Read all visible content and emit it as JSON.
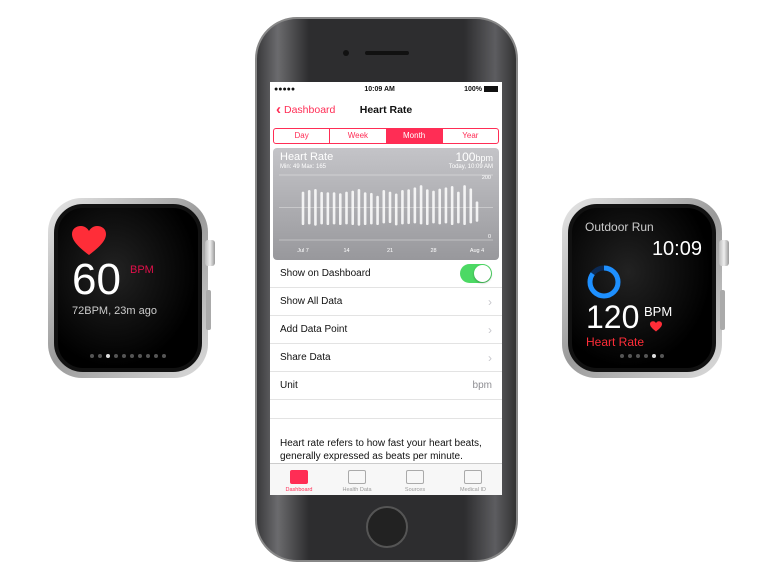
{
  "colors": {
    "accent": "#ff2d55",
    "toggle_on": "#4cd964",
    "ring": "#1e90ff"
  },
  "left_watch": {
    "icon": "heart-icon",
    "value": "60",
    "unit": "BPM",
    "sub": "72BPM, 23m ago",
    "page_count": 10,
    "page_active": 3
  },
  "right_watch": {
    "title": "Outdoor Run",
    "time": "10:09",
    "ring_progress": 0.85,
    "value": "120",
    "unit": "BPM",
    "label": "Heart Rate",
    "icon": "heart-icon",
    "page_count": 6,
    "page_active": 5
  },
  "phone": {
    "status": {
      "signal": "●●●●●",
      "time": "10:09 AM",
      "battery": "100%"
    },
    "nav": {
      "back": "Dashboard",
      "title": "Heart Rate"
    },
    "segments": [
      "Day",
      "Week",
      "Month",
      "Year"
    ],
    "active_segment": "Month",
    "rows": [
      {
        "label": "Show on Dashboard",
        "toggle": true
      },
      {
        "label": "Show All Data",
        "chevron": true
      },
      {
        "label": "Add Data Point",
        "chevron": true
      },
      {
        "label": "Share Data",
        "chevron": true
      },
      {
        "label": "Unit",
        "value": "bpm"
      }
    ],
    "description": "Heart rate refers to how fast your heart beats, generally expressed as beats per minute.",
    "tabs": [
      {
        "label": "Dashboard",
        "icon": "dashboard-icon",
        "active": true
      },
      {
        "label": "Health Data",
        "icon": "health-data-icon"
      },
      {
        "label": "Sources",
        "icon": "sources-icon"
      },
      {
        "label": "Medical ID",
        "icon": "medical-id-icon"
      }
    ]
  },
  "chart_data": {
    "type": "range-bar",
    "title": "Heart Rate",
    "summary": "Min: 49  Max: 165",
    "latest_value": "100",
    "latest_unit": "bpm",
    "latest_time": "Today, 10:09 AM",
    "ylim": [
      0,
      200
    ],
    "y_ticks": [
      "200",
      "0"
    ],
    "x_ticks": [
      "Jul 7",
      "14",
      "21",
      "28",
      "Aug 4"
    ],
    "ranges": [
      [
        50,
        145
      ],
      [
        52,
        150
      ],
      [
        48,
        153
      ],
      [
        52,
        144
      ],
      [
        50,
        143
      ],
      [
        52,
        143
      ],
      [
        50,
        140
      ],
      [
        52,
        145
      ],
      [
        50,
        148
      ],
      [
        48,
        153
      ],
      [
        50,
        143
      ],
      [
        52,
        141
      ],
      [
        50,
        132
      ],
      [
        55,
        150
      ],
      [
        56,
        145
      ],
      [
        49,
        139
      ],
      [
        52,
        150
      ],
      [
        53,
        152
      ],
      [
        55,
        158
      ],
      [
        52,
        165
      ],
      [
        50,
        152
      ],
      [
        55,
        148
      ],
      [
        52,
        154
      ],
      [
        55,
        158
      ],
      [
        50,
        162
      ],
      [
        55,
        145
      ],
      [
        50,
        165
      ],
      [
        55,
        155
      ],
      [
        60,
        115
      ]
    ]
  }
}
